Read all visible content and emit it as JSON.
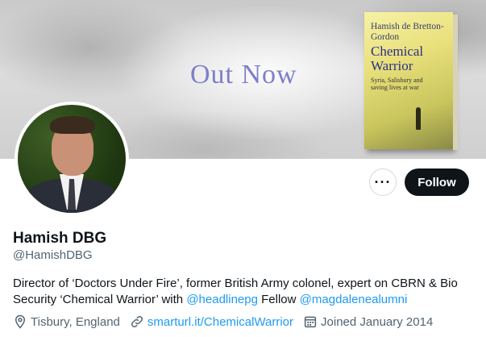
{
  "banner": {
    "text": "Out Now",
    "book_author": "Hamish de Bretton-Gordon",
    "book_title": "Chemical Warrior",
    "book_subtitle": "Syria, Salisbury and saving lives at war"
  },
  "profile": {
    "name": "Hamish DBG",
    "handle": "@HamishDBG",
    "follow_label": "Follow",
    "more_label": "···",
    "bio": {
      "part1": "Director of ‘Doctors Under Fire’, former British Army colonel, expert on CBRN & Bio Security ‘Chemical Warrior’ with ",
      "mention1": "@headlinepg",
      "part2": " Fellow ",
      "mention2": "@magdalenealumni"
    },
    "location": "Tisbury, England",
    "website": "smarturl.it/ChemicalWarrior",
    "joined": "Joined January 2014"
  },
  "colors": {
    "accent": "#1d9bf0",
    "follow_bg": "#0f1419",
    "secondary_text": "#536471",
    "banner_text": "#7d7fc9"
  }
}
